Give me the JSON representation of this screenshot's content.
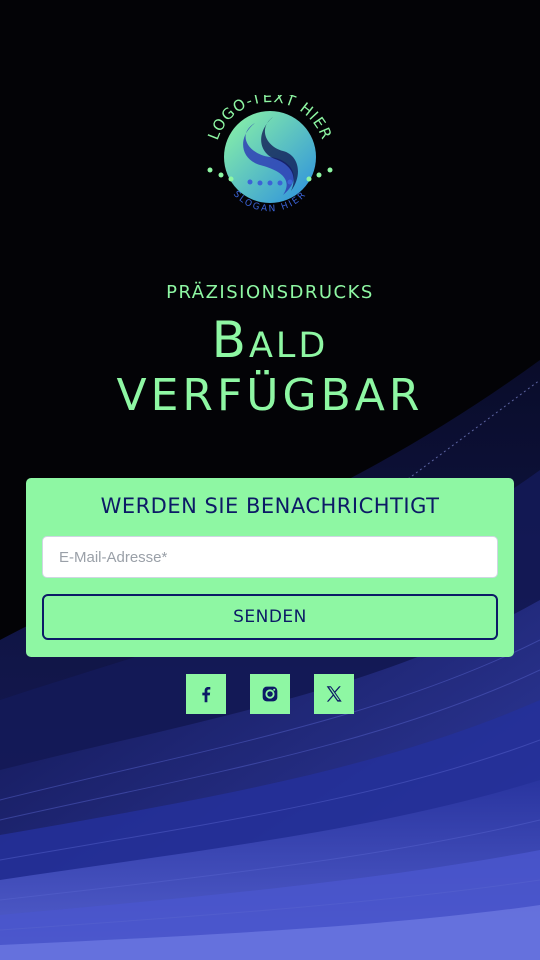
{
  "logo": {
    "text_top": "LOGO-TEXT HIER",
    "text_bottom": "SLOGAN HIER"
  },
  "hero": {
    "pre_title": "PRÄZISIONSDRUCKS",
    "title_line1": "Bald",
    "title_line2": "verfügbar"
  },
  "signup": {
    "title": "WERDEN SIE BENACHRICHTIGT",
    "email_placeholder": "E-Mail-Adresse*",
    "email_value": "",
    "submit_label": "SENDEN"
  },
  "social": [
    {
      "icon": "facebook-icon"
    },
    {
      "icon": "instagram-icon"
    },
    {
      "icon": "x-icon"
    }
  ],
  "colors": {
    "background": "#030306",
    "accent_green": "#8ef7a3",
    "navy": "#0c1a66",
    "wave_blue": "#2d3aa8"
  }
}
